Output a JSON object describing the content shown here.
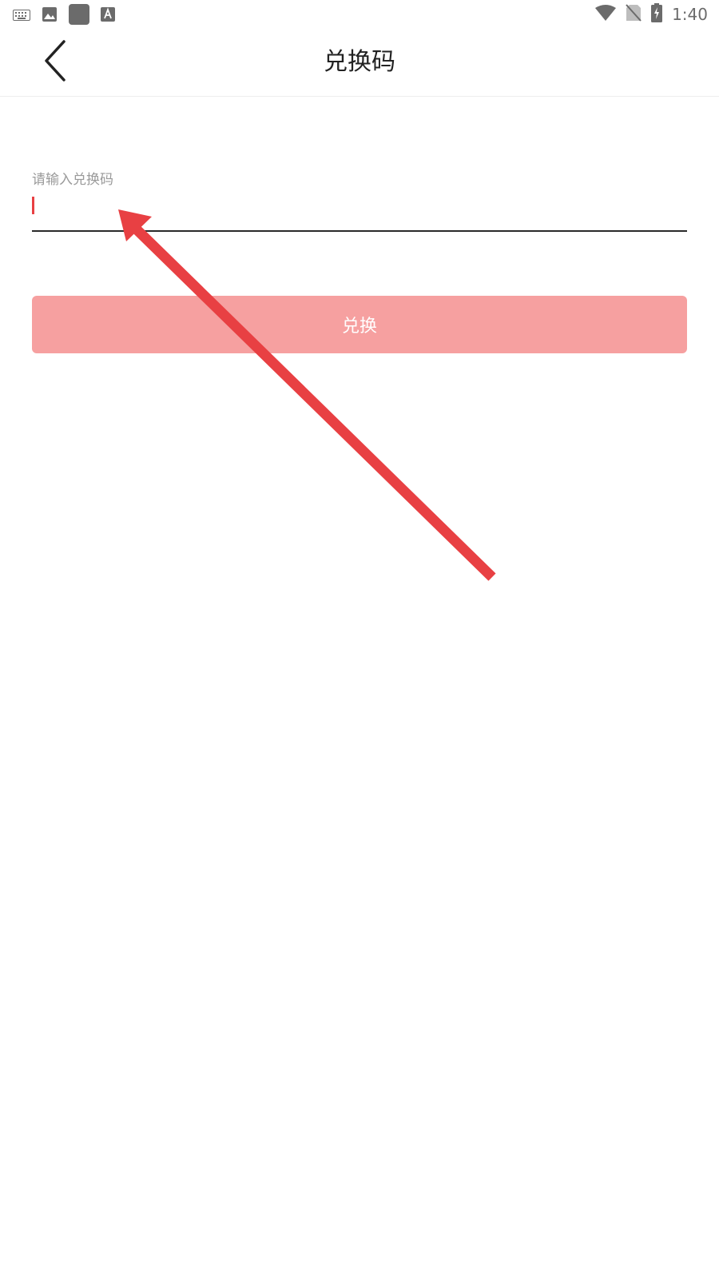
{
  "status_bar": {
    "time": "1:40",
    "left_icons": [
      "keyboard-icon",
      "image-icon",
      "app-square-icon",
      "font-a-icon"
    ],
    "right_icons": [
      "wifi-icon",
      "no-sim-icon",
      "battery-charging-icon"
    ]
  },
  "header": {
    "title": "兑换码",
    "back_icon": "chevron-left-icon"
  },
  "form": {
    "label": "请输入兑换码",
    "input_value": "",
    "button_label": "兑换"
  },
  "colors": {
    "accent": "#e84043",
    "button_bg": "#f6a0a0",
    "arrow": "#e84043"
  }
}
